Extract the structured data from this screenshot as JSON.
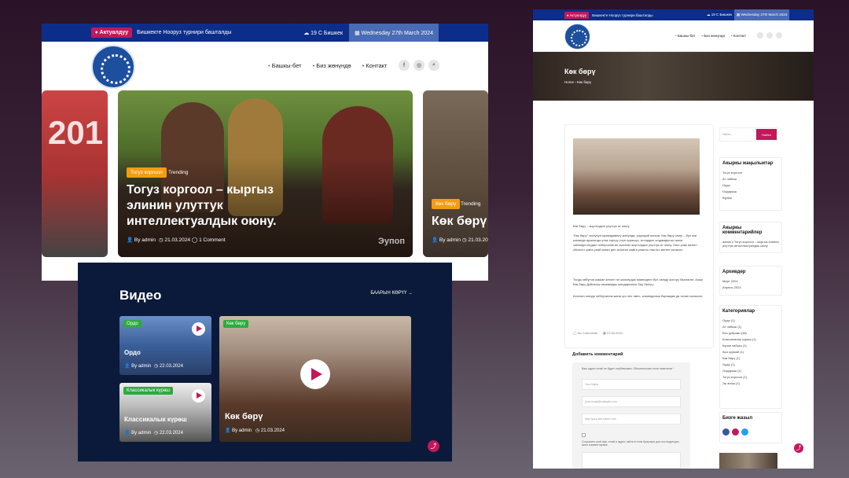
{
  "left": {
    "topbar": {
      "badge": "♦ Актуалдуу",
      "ticker": "Бишкекте Нооруз турнири башталды",
      "weather": "☁ 19 C Бишкек",
      "date": "▦ Wednesday 27th March 2024"
    },
    "nav": [
      "Башкы-бет",
      "Биз жөнүндө",
      "Контакт"
    ],
    "social": [
      "f",
      "◎",
      "⌕"
    ],
    "slide_main": {
      "category": "Тогуз коргоол",
      "trending": "Trending",
      "title": "Тогуз коргоол – кыргыз элинин улуттук интеллектуалдык оюну.",
      "author": "👤 By admin",
      "date": "◷ 21.03.2024",
      "comments": "◯ 1 Comment",
      "watermark": "Эупоп"
    },
    "slide_left": {
      "text": "201"
    },
    "slide_right": {
      "category": "Көк бөрү",
      "trending": "Trending",
      "title": "Көк бөрү",
      "author": "👤 By admin",
      "date": "◷ 21.03.20"
    },
    "video": {
      "heading": "Видео",
      "see_all": "БААРЫН КӨРҮҮ →",
      "cards": [
        {
          "badge": "Ордо",
          "title": "Ордо",
          "author": "👤 By admin",
          "date": "◷ 22.03.2024"
        },
        {
          "badge": "Классикалык күрөш",
          "title": "Классикалык күрөш",
          "author": "👤 By admin",
          "date": "◷ 22.03.2024"
        },
        {
          "badge": "Көк бөрү",
          "title": "Көк бөрү",
          "author": "👤 By admin",
          "date": "◷ 21.03.2024"
        }
      ]
    }
  },
  "right": {
    "topbar": {
      "badge": "♦ Актуалдуу",
      "ticker": "Бишкекте Нооруз турнири башталды",
      "weather": "☁ 19 C Бишкек",
      "date": "▦ Wednesday 27th March 2024"
    },
    "nav": [
      "Башкы-бет",
      "Биз жөнүндө",
      "Контакт"
    ],
    "hero_title": "Көк бөрү",
    "breadcrumb": "Home  ›  Көк бөрү",
    "article": {
      "intro": "Көк бөрү – кыргыздын улуттук ат оюну.",
      "p1": "\"Көк бөрү\" оюнунун мүнөздөмөсү жөнүндө, ушундай өзгөчө. Көк бөрү оюну – бул эки команда арасында улак тартуу үчүн күрөшүү, аттардын ылдамдыгын жана чабандестердин чеберчилигин сынаган кыргыздын улуттук ат оюну. Оюн улак менен ойнолот жана упай казан деп аталган жайга улакты таштоо менен саналат.",
      "p2": "Тоодо көбүнчө жашап кеткен эл жоокердик маанидеги бул оюнду жогору баалаган. Азыр Көк бөрү Дүйнөлүк көчмөндөр оюндарынын бир бөлүгү.",
      "p3": "Аталган оюнда чеберчилик жана күч эле эмес, командалык биримдик да талап кылынат.",
      "comments": "◯ No Comments",
      "date": "▦ 21.03.2024"
    },
    "comment": {
      "heading": "Добавить комментарий",
      "note": "Ваш адрес email не будет опубликован. Обязательные поля помечены *",
      "name": "Your Name",
      "email": "your-email@example.com",
      "url": "http://your-site-name.com",
      "save": "Сохранить моё имя, email и адрес сайта в этом браузере для последующих моих комментариев."
    },
    "search_placeholder": "Найти...",
    "search_btn": "Найти",
    "widgets": {
      "recent_h": "Акыркы жаңылыктар",
      "recent": [
        "Тогуз коргоол",
        "Ат чабыш",
        "Ордо",
        "Оодарыш",
        "Күрөш"
      ],
      "rc_h": "Акыркы комментарийлер",
      "rc": [
        "admin к Тогуз коргоол – кыргыз элинин улуттук интеллектуалдык оюну"
      ],
      "archive_h": "Архивдер",
      "archive": [
        "Март 2024",
        "Апрель 2024"
      ],
      "cat_h": "Категориялар",
      "cats": [
        "Ордо (1)",
        "Ат чабыш (1)",
        "Без рубрики (38)",
        "Классикалык күрөш (1)",
        "Кунан чабыш (1)",
        "Кыз куумай (1)",
        "Көк бөрү (1)",
        "Ордо (1)",
        "Оодарыш (1)",
        "Тогуз коргоол (1)",
        "Эр эниш (1)"
      ],
      "follow_h": "Бизге жазыл"
    }
  }
}
